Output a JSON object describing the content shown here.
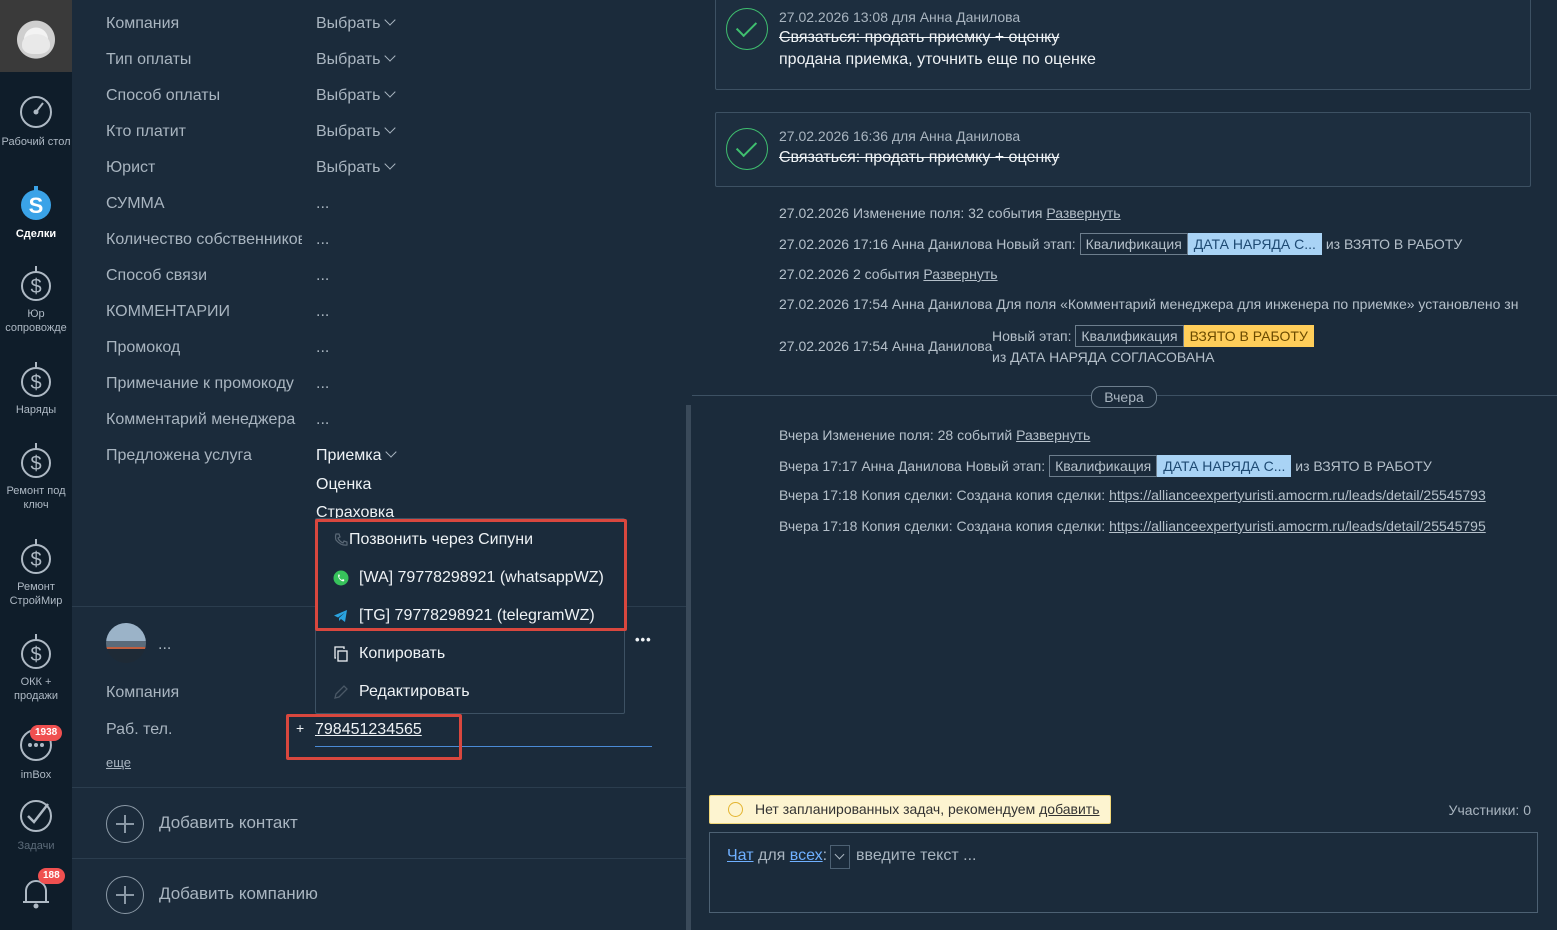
{
  "nav": {
    "items": [
      {
        "label": "Рабочий стол",
        "icon": "dashboard-icon"
      },
      {
        "label": "Сделки",
        "icon": "deals-icon"
      },
      {
        "label": "Юр сопровожде",
        "icon": "dollar-icon"
      },
      {
        "label": "Наряды",
        "icon": "dollar-icon"
      },
      {
        "label": "Ремонт под ключ",
        "icon": "dollar-icon"
      },
      {
        "label": "Ремонт СтройМир",
        "icon": "dollar-icon"
      },
      {
        "label": "ОКК + продажи",
        "icon": "dollar-icon"
      },
      {
        "label": "imBox",
        "icon": "chat-icon",
        "badge": "1938"
      },
      {
        "label": "Задачи",
        "icon": "check-icon"
      },
      {
        "label": "",
        "icon": "bell-icon",
        "badge": "188"
      }
    ]
  },
  "fields": [
    {
      "label": "Компания",
      "value": "Выбрать",
      "dropdown": true
    },
    {
      "label": "Тип оплаты",
      "value": "Выбрать",
      "dropdown": true
    },
    {
      "label": "Способ оплаты",
      "value": "Выбрать",
      "dropdown": true
    },
    {
      "label": "Кто платит",
      "value": "Выбрать",
      "dropdown": true
    },
    {
      "label": "Юрист",
      "value": "Выбрать",
      "dropdown": true
    },
    {
      "label": "СУММА",
      "value": "..."
    },
    {
      "label": "Количество собственников",
      "value": "..."
    },
    {
      "label": "Способ связи",
      "value": "..."
    },
    {
      "label": "КОММЕНТАРИИ",
      "value": "..."
    },
    {
      "label": "Промокод",
      "value": "..."
    },
    {
      "label": "Примечание к промокоду",
      "value": "..."
    },
    {
      "label": "Комментарий менеджера",
      "value": "..."
    }
  ],
  "service": {
    "label": "Предложена услуга",
    "options": [
      "Приемка",
      "Оценка",
      "Страховка"
    ]
  },
  "contact": {
    "name": "...",
    "company_label": "Компания",
    "phone_label": "Раб. тел.",
    "phone_plus": "+",
    "phone_value": "798451234565",
    "more": "еще",
    "dots": "•••"
  },
  "menu": {
    "items": [
      {
        "label": "Позвонить через Сипуни",
        "icon": "phone-icon"
      },
      {
        "label": "[WA] 79778298921 (whatsappWZ)",
        "icon": "whatsapp-icon"
      },
      {
        "label": "[TG] 79778298921 (telegramWZ)",
        "icon": "telegram-icon"
      },
      {
        "label": "Копировать",
        "icon": "copy-icon"
      },
      {
        "label": "Редактировать",
        "icon": "pencil-icon"
      }
    ]
  },
  "add_contact": "Добавить контакт",
  "add_company": "Добавить компанию",
  "feed": {
    "tasks": [
      {
        "meta": "27.02.2026 13:08  для Анна Данилова",
        "title": "Связаться: продать приемку + оценку",
        "result": "продана приемка, уточнить еще по оценке"
      },
      {
        "meta": "27.02.2026 16:36  для Анна Данилова",
        "title": "Связаться: продать приемку + оценку",
        "result": ""
      }
    ],
    "events": [
      {
        "text": "27.02.2026 Изменение поля: 32 события",
        "link": "Развернуть"
      },
      {
        "text": "27.02.2026 17:16 Анна Данилова Новый этап:",
        "tag1": "Квалификация",
        "tag2": "ДАТА НАРЯДА С...",
        "tail": "из ВЗЯТО В РАБОТУ"
      },
      {
        "text": "27.02.2026 2 события",
        "link": "Развернуть"
      },
      {
        "text": "27.02.2026 17:54 Анна Данилова Для поля «Комментарий менеджера для инженера по приемке» установлено зн"
      },
      {
        "text": "27.02.2026 17:54 Анна Данилова",
        "stage_label": "Новый этап:",
        "tag1": "Квалификация",
        "tag2": "ВЗЯТО В РАБОТУ",
        "tail": "из ДАТА НАРЯДА СОГЛАСОВАНА"
      }
    ],
    "day_separator": "Вчера",
    "events_yesterday": [
      {
        "text": "Вчера Изменение поля: 28 событий",
        "link": "Развернуть"
      },
      {
        "text": "Вчера 17:17 Анна Данилова Новый этап:",
        "tag1": "Квалификация",
        "tag2": "ДАТА НАРЯДА С...",
        "tail": "из ВЗЯТО В РАБОТУ"
      },
      {
        "text": "Вчера 17:18 Копия сделки: Создана копия сделки:",
        "link": "https://allianceexpertyuristi.amocrm.ru/leads/detail/25545793"
      },
      {
        "text": "Вчера 17:18 Копия сделки: Создана копия сделки:",
        "link": "https://allianceexpertyuristi.amocrm.ru/leads/detail/25545795"
      }
    ],
    "notice": {
      "text": "Нет запланированных задач, рекомендуем",
      "link": "добавить"
    },
    "participants": "Участники: 0",
    "chat": {
      "chat_link": "Чат",
      "for": "для",
      "all_link": "всех",
      "colon": ":",
      "placeholder": "введите текст ..."
    }
  },
  "colors": {
    "accent": "#6fb0ff",
    "stage_blue": "#a9d3f5",
    "stage_yellow": "#ffce5a",
    "alert_red": "#d9473e"
  }
}
